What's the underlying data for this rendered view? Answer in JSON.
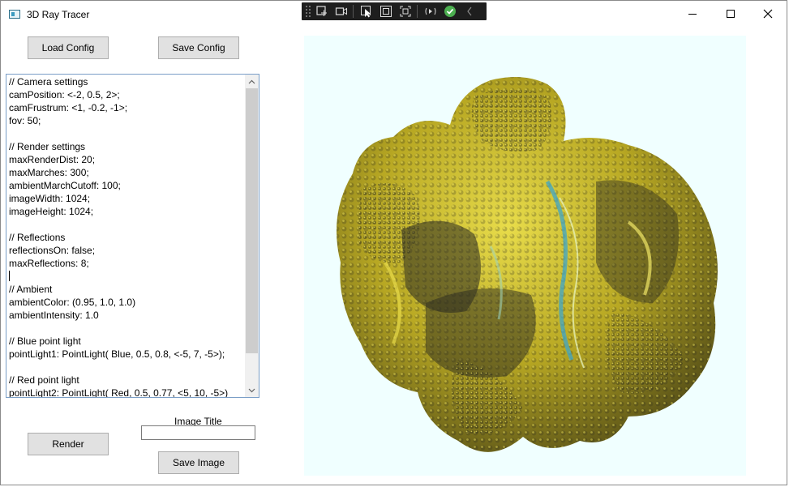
{
  "window": {
    "title": "3D Ray Tracer",
    "controls": [
      "minimize-icon",
      "maximize-icon",
      "close-icon"
    ]
  },
  "debug_toolbar": {
    "icons": [
      "grip-icon",
      "select-element-icon",
      "video-icon",
      "pointer-icon",
      "layout-adorner-icon",
      "track-focus-icon",
      "hot-reload-icon",
      "checkmark-icon",
      "collapse-chevron-icon"
    ],
    "accent": "#4caf50"
  },
  "buttons": {
    "load_config": "Load Config",
    "save_config": "Save Config",
    "render": "Render",
    "save_image": "Save Image"
  },
  "editor": {
    "lines": [
      "// Camera settings",
      "camPosition: <-2, 0.5, 2>;",
      "camFrustrum: <1, -0.2, -1>;",
      "fov: 50;",
      "",
      "// Render settings",
      "maxRenderDist: 20;",
      "maxMarches: 300;",
      "ambientMarchCutoff: 100;",
      "imageWidth: 1024;",
      "imageHeight: 1024;",
      "",
      "// Reflections",
      "reflectionsOn: false;",
      "maxReflections: 8;",
      "",
      "// Ambient",
      "ambientColor: (0.95, 1.0, 1.0)",
      "ambientIntensity: 1.0",
      "",
      "// Blue point light",
      "pointLight1: PointLight( Blue, 0.5, 0.8, <-5, 7, -5>);",
      "",
      "// Red point light",
      "pointLight2: PointLight( Red, 0.5, 0.77, <5, 10, -5>)"
    ],
    "caret_line": 15
  },
  "image_title": {
    "label": "Image Title",
    "value": ""
  },
  "render": {
    "background": "#f0ffff",
    "fractal_color": "#b8a823",
    "shadow_color": "#2a2a20",
    "highlight_color": "#e8dc4a",
    "accent_color": "#3fa6c8"
  }
}
